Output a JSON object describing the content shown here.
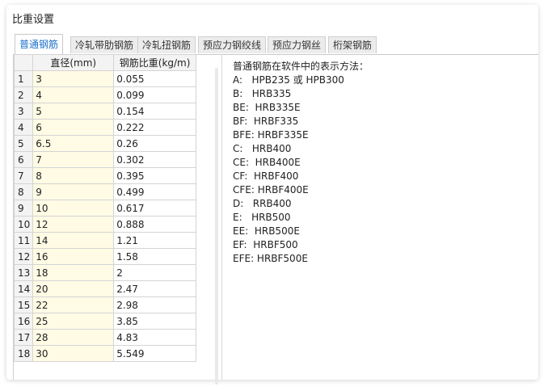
{
  "dialog": {
    "title": "比重设置"
  },
  "tabs": [
    {
      "label": "普通钢筋",
      "active": true
    },
    {
      "label": "冷轧带肋钢筋",
      "active": false
    },
    {
      "label": "冷轧扭钢筋",
      "active": false
    },
    {
      "label": "预应力钢绞线",
      "active": false
    },
    {
      "label": "预应力钢丝",
      "active": false
    },
    {
      "label": "桁架钢筋",
      "active": false
    }
  ],
  "table": {
    "columns": [
      "直径(mm)",
      "钢筋比重(kg/m)"
    ],
    "rows": [
      {
        "num": "1",
        "diameter": "3",
        "weight": "0.055"
      },
      {
        "num": "2",
        "diameter": "4",
        "weight": "0.099"
      },
      {
        "num": "3",
        "diameter": "5",
        "weight": "0.154"
      },
      {
        "num": "4",
        "diameter": "6",
        "weight": "0.222"
      },
      {
        "num": "5",
        "diameter": "6.5",
        "weight": "0.26"
      },
      {
        "num": "6",
        "diameter": "7",
        "weight": "0.302"
      },
      {
        "num": "7",
        "diameter": "8",
        "weight": "0.395"
      },
      {
        "num": "8",
        "diameter": "9",
        "weight": "0.499"
      },
      {
        "num": "9",
        "diameter": "10",
        "weight": "0.617"
      },
      {
        "num": "10",
        "diameter": "12",
        "weight": "0.888"
      },
      {
        "num": "11",
        "diameter": "14",
        "weight": "1.21"
      },
      {
        "num": "12",
        "diameter": "16",
        "weight": "1.58"
      },
      {
        "num": "13",
        "diameter": "18",
        "weight": "2"
      },
      {
        "num": "14",
        "diameter": "20",
        "weight": "2.47"
      },
      {
        "num": "15",
        "diameter": "22",
        "weight": "2.98"
      },
      {
        "num": "16",
        "diameter": "25",
        "weight": "3.85"
      },
      {
        "num": "17",
        "diameter": "28",
        "weight": "4.83"
      },
      {
        "num": "18",
        "diameter": "30",
        "weight": "5.549"
      }
    ]
  },
  "info": {
    "lines": [
      "普通钢筋在软件中的表示方法：",
      "A:   HPB235 或 HPB300",
      "B:   HRB335",
      "BE:  HRB335E",
      "BF:  HRBF335",
      "BFE: HRBF335E",
      "C:   HRB400",
      "CE:  HRB400E",
      "CF:  HRBF400",
      "CFE: HRBF400E",
      "D:   RRB400",
      "E:   HRB500",
      "EE:  HRB500E",
      "EF:  HRBF500",
      "EFE: HRBF500E"
    ]
  }
}
